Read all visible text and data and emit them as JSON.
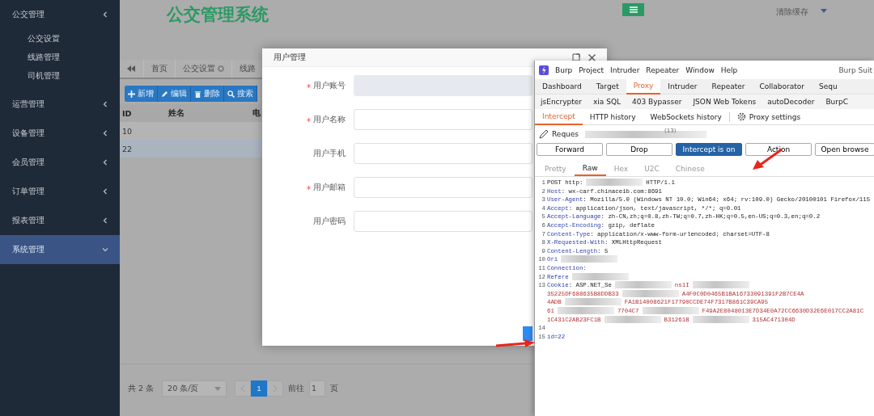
{
  "app_title": "公交管理系统",
  "header": {
    "clear_cache": "清除缓存"
  },
  "sidebar": {
    "items": [
      {
        "label": "公交管理",
        "expanded": false,
        "selected": false,
        "children": [
          {
            "label": "公交设置"
          },
          {
            "label": "线路管理"
          },
          {
            "label": "司机管理"
          }
        ]
      },
      {
        "label": "运营管理",
        "expanded": false,
        "selected": false
      },
      {
        "label": "设备管理",
        "expanded": false,
        "selected": false
      },
      {
        "label": "会员管理",
        "expanded": false,
        "selected": false
      },
      {
        "label": "订单管理",
        "expanded": false,
        "selected": false
      },
      {
        "label": "报表管理",
        "expanded": false,
        "selected": false
      },
      {
        "label": "系统管理",
        "expanded": true,
        "selected": true
      }
    ]
  },
  "tabs": [
    {
      "label": "首页",
      "closable": false
    },
    {
      "label": "公交设置",
      "closable": true
    },
    {
      "label": "线路",
      "closable": false
    }
  ],
  "toolbar": [
    {
      "kind": "plus",
      "label": "新增"
    },
    {
      "kind": "pencil",
      "label": "编辑"
    },
    {
      "kind": "trash",
      "label": "删除"
    },
    {
      "kind": "search",
      "label": "搜索"
    }
  ],
  "table": {
    "columns": [
      "ID",
      "姓名",
      "电"
    ],
    "rows": [
      {
        "id": "10"
      },
      {
        "id": "22"
      }
    ]
  },
  "pagination": {
    "total": "共 2 条",
    "page_size": "20 条/页",
    "pages": [
      {
        "label": "1",
        "selected": true
      }
    ],
    "goto_label": "前往",
    "goto_value": "1",
    "page_suffix": "页"
  },
  "dialog": {
    "title": "用户管理",
    "fields": [
      {
        "label": "用户账号",
        "required": true,
        "disabled": true
      },
      {
        "label": "用户名称",
        "required": true,
        "disabled": false
      },
      {
        "label": "用户手机",
        "required": false,
        "disabled": false
      },
      {
        "label": "用户邮箱",
        "required": true,
        "disabled": false
      },
      {
        "label": "用户密码",
        "required": false,
        "disabled": false
      }
    ]
  },
  "burp": {
    "menu": [
      "Burp",
      "Project",
      "Intruder",
      "Repeater",
      "Window",
      "Help"
    ],
    "title": "Burp Suit",
    "tabs": [
      {
        "label": "Dashboard",
        "selected": false
      },
      {
        "label": "Target",
        "selected": false
      },
      {
        "label": "Proxy",
        "selected": true
      },
      {
        "label": "Intruder",
        "selected": false
      },
      {
        "label": "Repeater",
        "selected": false
      },
      {
        "label": "Collaborator",
        "selected": false
      },
      {
        "label": "Sequ",
        "selected": false
      }
    ],
    "extension_tabs": [
      "jsEncrypter",
      "xia SQL",
      "403 Bypasser",
      "JSON Web Tokens",
      "autoDecoder",
      "BurpC"
    ],
    "sub_tabs": [
      {
        "label": "Intercept",
        "selected": true
      },
      {
        "label": "HTTP history",
        "selected": false
      },
      {
        "label": "WebSockets history",
        "selected": false
      }
    ],
    "settings_label": "Proxy settings",
    "request_label": "Reques",
    "request_count": "(13)",
    "buttons": [
      {
        "label": "Forward",
        "on": false
      },
      {
        "label": "Drop",
        "on": false
      },
      {
        "label": "Intercept is on",
        "on": true
      },
      {
        "label": "Action",
        "on": false
      },
      {
        "label": "Open browse",
        "on": false
      }
    ],
    "editor_tabs": [
      {
        "label": "Pretty",
        "selected": false
      },
      {
        "label": "Raw",
        "selected": true
      },
      {
        "label": "Hex",
        "selected": false
      },
      {
        "label": "U2C",
        "selected": false
      },
      {
        "label": "Chinese",
        "selected": false
      }
    ],
    "lines": [
      {
        "number": "1",
        "parts": [
          {
            "kind": "plain",
            "text": "POST http:"
          },
          {
            "kind": "redacted"
          },
          {
            "kind": "plain",
            "text": "HTTP/1.1"
          }
        ]
      },
      {
        "number": "2",
        "parts": [
          {
            "kind": "name",
            "text": "Host"
          },
          {
            "kind": "plain",
            "text": ": wx-carf.chinaceib.com:8691"
          }
        ]
      },
      {
        "number": "3",
        "parts": [
          {
            "kind": "name",
            "text": "User-Agent"
          },
          {
            "kind": "plain",
            "text": ": Mozilla/5.0 (Windows NT 10.0; Win64; x64; rv:109.0) Gecko/20100101 Firefox/115"
          }
        ]
      },
      {
        "number": "4",
        "parts": [
          {
            "kind": "name",
            "text": "Accept"
          },
          {
            "kind": "plain",
            "text": ": application/json, text/javascript, */*; q=0.01"
          }
        ]
      },
      {
        "number": "5",
        "parts": [
          {
            "kind": "name",
            "text": "Accept-Language"
          },
          {
            "kind": "plain",
            "text": ": zh-CN,zh;q=0.8,zh-TW;q=0.7,zh-HK;q=0.5,en-US;q=0.3,en;q=0.2"
          }
        ]
      },
      {
        "number": "6",
        "parts": [
          {
            "kind": "name",
            "text": "Accept-Encoding"
          },
          {
            "kind": "plain",
            "text": ": gzip, deflate"
          }
        ]
      },
      {
        "number": "7",
        "parts": [
          {
            "kind": "name",
            "text": "Content-Type"
          },
          {
            "kind": "plain",
            "text": ": application/x-www-form-urlencoded; charset=UTF-8"
          }
        ]
      },
      {
        "number": "8",
        "parts": [
          {
            "kind": "name",
            "text": "X-Requested-With"
          },
          {
            "kind": "plain",
            "text": ": XMLHttpRequest"
          }
        ]
      },
      {
        "number": "9",
        "parts": [
          {
            "kind": "name",
            "text": "Content-Length"
          },
          {
            "kind": "plain",
            "text": ": 5"
          }
        ]
      },
      {
        "number": "10",
        "parts": [
          {
            "kind": "name",
            "text": "Ori"
          },
          {
            "kind": "redacted"
          }
        ]
      },
      {
        "number": "11",
        "parts": [
          {
            "kind": "name",
            "text": "Connection:"
          }
        ]
      },
      {
        "number": "12",
        "parts": [
          {
            "kind": "name",
            "text": "Refere"
          },
          {
            "kind": "redacted"
          }
        ]
      },
      {
        "number": "13",
        "parts": [
          {
            "kind": "name",
            "text": "Cookie"
          },
          {
            "kind": "plain",
            "text": ": ASP.NET_Se"
          },
          {
            "kind": "redacted"
          },
          {
            "kind": "value",
            "text": "ns1I"
          },
          {
            "kind": "redacted"
          }
        ]
      },
      {
        "parts": [
          {
            "kind": "value",
            "text": "35225DF688635B8DDB33"
          },
          {
            "kind": "redacted"
          },
          {
            "kind": "value",
            "text": "A4F0C0D0465B1BA16733091391F2B7CE4A"
          }
        ]
      },
      {
        "parts": [
          {
            "kind": "value",
            "text": "4ADB"
          },
          {
            "kind": "redacted"
          },
          {
            "kind": "value",
            "text": "FA1B14008621F17790CCDE74F7317B861C39CA95"
          }
        ]
      },
      {
        "parts": [
          {
            "kind": "value",
            "text": "61"
          },
          {
            "kind": "redacted"
          },
          {
            "kind": "value",
            "text": "7704C7"
          },
          {
            "kind": "redacted"
          },
          {
            "kind": "value",
            "text": "F49A2E8048013E7D34E0A72CC6630D32E6E017CC2A81C"
          }
        ]
      },
      {
        "parts": [
          {
            "kind": "value",
            "text": "1C431C2AB23FC1B"
          },
          {
            "kind": "redacted"
          },
          {
            "kind": "value",
            "text": "B31261B"
          },
          {
            "kind": "redacted"
          },
          {
            "kind": "value",
            "text": "315AC471304D"
          }
        ]
      },
      {
        "number": "14"
      },
      {
        "number": "15",
        "parts": [
          {
            "kind": "body",
            "text": "id=22"
          }
        ]
      }
    ]
  }
}
